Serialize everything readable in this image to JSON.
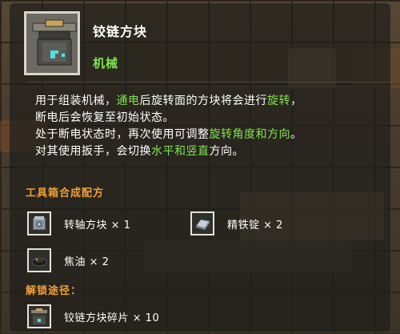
{
  "item": {
    "name": "铰链方块",
    "category": "机械",
    "icon": "hinge-block-icon"
  },
  "description": {
    "line1": [
      "用于组装机械，",
      "通电",
      "后旋转面的方块将会进行",
      "旋转",
      "，"
    ],
    "line2": "断电后会恢复至初始状态。",
    "line3": [
      "处于断电状态时，再次使用可调整",
      "旋转角度和方向",
      "。"
    ],
    "line4": [
      "对其使用扳手，会切换",
      "水平和竖直",
      "方向。"
    ]
  },
  "recipe": {
    "title": "工具箱合成配方",
    "ingredients": [
      {
        "name": "转轴方块",
        "qty": "× 1",
        "icon": "axis-block-icon"
      },
      {
        "name": "精铁锭",
        "qty": "× 2",
        "icon": "iron-ingot-icon"
      },
      {
        "name": "焦油",
        "qty": "× 2",
        "icon": "tar-icon"
      }
    ]
  },
  "unlock": {
    "title": "解锁途径：",
    "items": [
      {
        "name": "铰链方块碎片",
        "qty": "× 10",
        "icon": "hinge-block-fragment-icon"
      }
    ]
  },
  "colors": {
    "highlight": "#7ee34f",
    "section": "#f0a03a",
    "text": "#ffffff"
  }
}
